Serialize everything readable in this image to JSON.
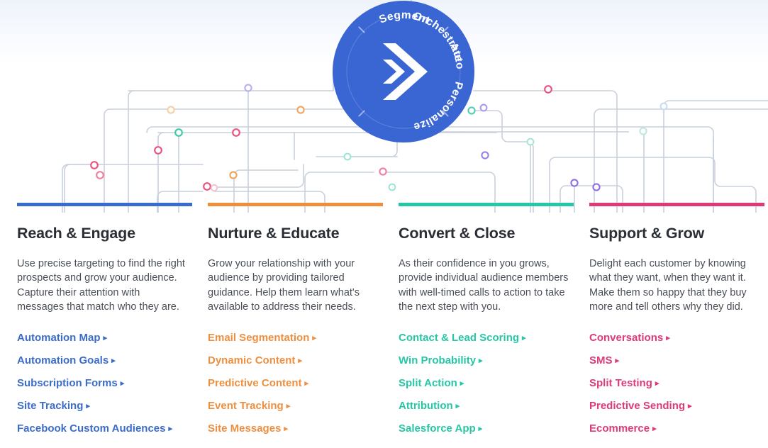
{
  "hub": {
    "brand_mark": "chevron-right-logo",
    "background_color": "#3A66D4",
    "labels": {
      "top": "Orchestrate",
      "right": "Automate",
      "bottom": "Personalize",
      "left": "Segment"
    }
  },
  "columns": [
    {
      "id": "reach-engage",
      "title": "Reach & Engage",
      "accent_color": "#3C6CCB",
      "description": "Use precise targeting to find the right prospects and grow your audience. Capture their attention with messages that match who they are.",
      "links": [
        "Automation Map",
        "Automation Goals",
        "Subscription Forms",
        "Site Tracking",
        "Facebook Custom Audiences"
      ]
    },
    {
      "id": "nurture-educate",
      "title": "Nurture & Educate",
      "accent_color": "#EE8F3F",
      "description": "Grow your relationship with your audience by providing tailored guidance. Help them learn what's available to address their needs.",
      "links": [
        "Email Segmentation",
        "Dynamic Content",
        "Predictive Content",
        "Event Tracking",
        "Site Messages"
      ]
    },
    {
      "id": "convert-close",
      "title": "Convert & Close",
      "accent_color": "#25C7A6",
      "description": "As their confidence in you grows, provide individual audience members with well-timed calls to action to take the next step with you.",
      "links": [
        "Contact & Lead Scoring",
        "Win Probability",
        "Split Action",
        "Attribution",
        "Salesforce App"
      ]
    },
    {
      "id": "support-grow",
      "title": "Support & Grow",
      "accent_color": "#DE3A78",
      "description": "Delight each customer by knowing what they want, when they want it. Make them so happy that they buy more and tell others why they did.",
      "links": [
        "Conversations",
        "SMS",
        "Split Testing",
        "Predictive Sending",
        "Ecommerce"
      ]
    }
  ],
  "link_arrow_glyph": "▸",
  "network": {
    "line_color": "#c9d0dc",
    "node_colors": {
      "pink": "#e8547f",
      "pink_soft": "#f3a9c0",
      "orange": "#f0a35e",
      "orange_soft": "#f8d3ae",
      "teal": "#3fc9a8",
      "teal_soft": "#a7e5d6",
      "purple": "#8e6fe0",
      "purple_soft": "#bcb2ee"
    }
  }
}
